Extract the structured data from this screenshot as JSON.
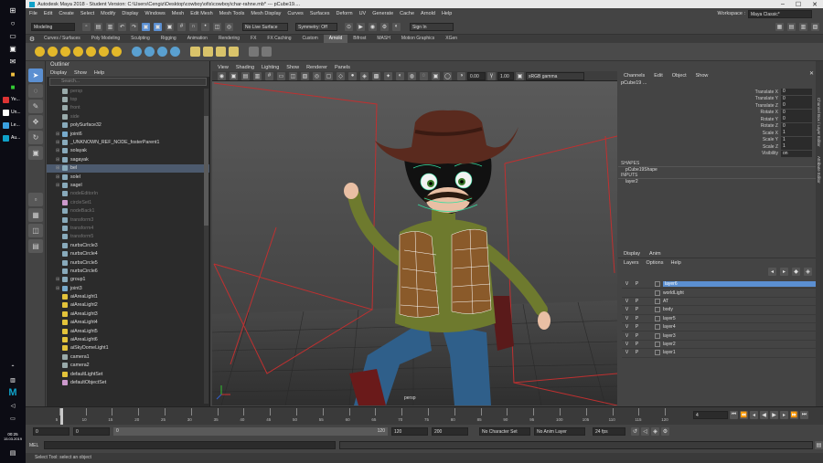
{
  "taskbar": {
    "apps": [
      {
        "label": "Ye...",
        "color": "#d33"
      },
      {
        "label": "Un...",
        "color": "#fff"
      },
      {
        "label": "Le...",
        "color": "#3aa0e0"
      },
      {
        "label": "Au...",
        "color": "#0fa1c8"
      }
    ],
    "time": "00:25",
    "date": "15.03.2019"
  },
  "window": {
    "title": "Autodesk Maya 2018 - Student Version: C:\\Users\\Cengiz\\Desktop\\cowboy\\ofis\\cowboy\\char-rahne.mb*   ---   pCube19...."
  },
  "menus": [
    "File",
    "Edit",
    "Create",
    "Select",
    "Modify",
    "Display",
    "Windows",
    "Mesh",
    "Edit Mesh",
    "Mesh Tools",
    "Mesh Display",
    "Curves",
    "Surfaces",
    "Deform",
    "UV",
    "Generate",
    "Cache",
    "Arnold",
    "Help"
  ],
  "workspace": {
    "label": "Workspace :",
    "value": "Maya Classic*"
  },
  "statusline": {
    "mode": "Modeling",
    "live_surface": "No Live Surface",
    "symmetry": "Symmetry: Off",
    "signin": "Sign In"
  },
  "shelf_tabs": [
    "Curves / Surfaces",
    "Poly Modeling",
    "Sculpting",
    "Rigging",
    "Animation",
    "Rendering",
    "FX",
    "FX Caching",
    "Custom",
    "Arnold",
    "Bifrost",
    "MASH",
    "Motion Graphics",
    "XGen"
  ],
  "shelf_active": "Arnold",
  "outliner": {
    "title": "Outliner",
    "menu": [
      "Display",
      "Show",
      "Help"
    ],
    "search": "Search...",
    "items": [
      {
        "label": "persp",
        "dim": true,
        "exp": ""
      },
      {
        "label": "top",
        "dim": true,
        "exp": ""
      },
      {
        "label": "front",
        "dim": true,
        "exp": ""
      },
      {
        "label": "side",
        "dim": true,
        "exp": ""
      },
      {
        "label": "polySurface32",
        "dim": false,
        "exp": ""
      },
      {
        "label": "joint6",
        "dim": false,
        "exp": "+"
      },
      {
        "label": "_UNKNOWN_REF_NODE_fosterParent1",
        "dim": false,
        "exp": "+"
      },
      {
        "label": "solayak",
        "dim": false,
        "exp": "+"
      },
      {
        "label": "sagayak",
        "dim": false,
        "exp": "+"
      },
      {
        "label": "bel",
        "dim": false,
        "exp": "+",
        "sel": true
      },
      {
        "label": "solel",
        "dim": false,
        "exp": "+"
      },
      {
        "label": "sagel",
        "dim": false,
        "exp": "+"
      },
      {
        "label": "nodeEditorIn",
        "dim": true,
        "exp": ""
      },
      {
        "label": "circleSet1",
        "dim": true,
        "exp": ""
      },
      {
        "label": "nodeBack1",
        "dim": true,
        "exp": ""
      },
      {
        "label": "transform3",
        "dim": true,
        "exp": ""
      },
      {
        "label": "transform4",
        "dim": true,
        "exp": ""
      },
      {
        "label": "transform5",
        "dim": true,
        "exp": ""
      },
      {
        "label": "nurbsCircle3",
        "dim": false,
        "exp": ""
      },
      {
        "label": "nurbsCircle4",
        "dim": false,
        "exp": ""
      },
      {
        "label": "nurbsCircle5",
        "dim": false,
        "exp": ""
      },
      {
        "label": "nurbsCircle6",
        "dim": false,
        "exp": ""
      },
      {
        "label": "group1",
        "dim": false,
        "exp": "+"
      },
      {
        "label": "joint3",
        "dim": false,
        "exp": "+"
      },
      {
        "label": "aiAreaLight1",
        "dim": false,
        "exp": ""
      },
      {
        "label": "aiAreaLight2",
        "dim": false,
        "exp": ""
      },
      {
        "label": "aiAreaLight3",
        "dim": false,
        "exp": ""
      },
      {
        "label": "aiAreaLight4",
        "dim": false,
        "exp": ""
      },
      {
        "label": "aiAreaLight5",
        "dim": false,
        "exp": ""
      },
      {
        "label": "aiAreaLight6",
        "dim": false,
        "exp": ""
      },
      {
        "label": "aiSkyDomeLight1",
        "dim": false,
        "exp": ""
      },
      {
        "label": "camera1",
        "dim": false,
        "exp": ""
      },
      {
        "label": "camera2",
        "dim": false,
        "exp": ""
      },
      {
        "label": "defaultLightSet",
        "dim": false,
        "exp": ""
      },
      {
        "label": "defaultObjectSet",
        "dim": false,
        "exp": ""
      }
    ]
  },
  "viewport": {
    "menu": [
      "View",
      "Shading",
      "Lighting",
      "Show",
      "Renderer",
      "Panels"
    ],
    "val_a": "0.00",
    "val_b": "1.00",
    "colorspace": "sRGB gamma",
    "camera": "persp"
  },
  "channelbox": {
    "menu": [
      "Channels",
      "Edit",
      "Object",
      "Show"
    ],
    "object": "pCube19 ...",
    "attrs": [
      {
        "n": "Translate X",
        "v": "0"
      },
      {
        "n": "Translate Y",
        "v": "0"
      },
      {
        "n": "Translate Z",
        "v": "0"
      },
      {
        "n": "Rotate X",
        "v": "0"
      },
      {
        "n": "Rotate Y",
        "v": "0"
      },
      {
        "n": "Rotate Z",
        "v": "0"
      },
      {
        "n": "Scale X",
        "v": "1"
      },
      {
        "n": "Scale Y",
        "v": "1"
      },
      {
        "n": "Scale Z",
        "v": "1"
      },
      {
        "n": "Visibility",
        "v": "on"
      }
    ],
    "shapes_label": "SHAPES",
    "shape_name": "pCube19Shape",
    "inputs_label": "INPUTS",
    "input_name": "layer2"
  },
  "layers": {
    "tabs": [
      "Display",
      "Anim"
    ],
    "menu": [
      "Layers",
      "Options",
      "Help"
    ],
    "rows": [
      {
        "v": "V",
        "p": "P",
        "name": "layer6",
        "sel": true
      },
      {
        "v": "",
        "p": "",
        "name": "worldLight",
        "sel": false
      },
      {
        "v": "V",
        "p": "P",
        "name": "AT",
        "sel": false
      },
      {
        "v": "V",
        "p": "P",
        "name": "body",
        "sel": false
      },
      {
        "v": "V",
        "p": "P",
        "name": "layer5",
        "sel": false
      },
      {
        "v": "V",
        "p": "P",
        "name": "layer4",
        "sel": false
      },
      {
        "v": "V",
        "p": "P",
        "name": "layer3",
        "sel": false
      },
      {
        "v": "V",
        "p": "P",
        "name": "layer2",
        "sel": false
      },
      {
        "v": "V",
        "p": "P",
        "name": "layer1",
        "sel": false
      }
    ]
  },
  "timeline": {
    "ticks": [
      "5",
      "10",
      "15",
      "20",
      "25",
      "30",
      "35",
      "40",
      "45",
      "50",
      "55",
      "60",
      "65",
      "70",
      "75",
      "80",
      "85",
      "90",
      "95",
      "100",
      "105",
      "110",
      "115",
      "120"
    ],
    "current_frame": "4",
    "range_start": "0",
    "range_start2": "0",
    "range_inner_start": "0",
    "range_inner_end": "120",
    "range_end": "120",
    "range_end2": "200",
    "char_set": "No Character Set",
    "anim_layer": "No Anim Layer",
    "fps": "24 fps"
  },
  "mel": {
    "label": "MEL"
  },
  "help": "Select Tool: select an object",
  "sidetabs": [
    "Channel Box / Layer Editor",
    "Attribute Editor"
  ]
}
